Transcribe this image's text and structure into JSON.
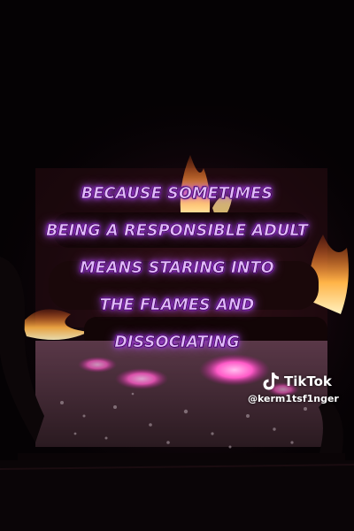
{
  "caption": {
    "lines": [
      "BECAUSE SOMETIMES",
      "BEING A RESPONSIBLE ADULT",
      "MEANS STARING INTO",
      "THE FLAMES AND",
      "DISSOCIATING"
    ],
    "color": "#e2b8ff",
    "glow_color": "#b040ff"
  },
  "watermark": {
    "brand": "TikTok",
    "handle": "@kerm1tsf1nger",
    "icon": "tiktok-logo-icon"
  },
  "scene": {
    "subject": "fireplace-fire",
    "colors": {
      "flame": "#ffb347",
      "ember": "#ff5ac8",
      "ash": "#8a7f86"
    }
  }
}
